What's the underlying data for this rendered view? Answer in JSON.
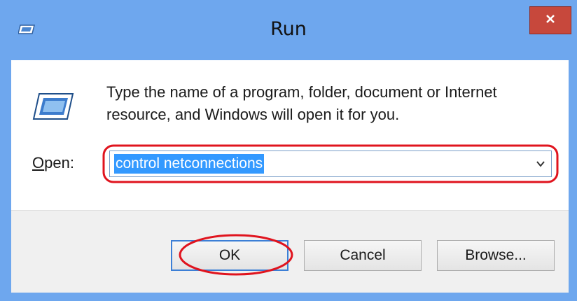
{
  "window": {
    "title": "Run",
    "title_color": "#6ea7ee",
    "close_icon": "close-icon"
  },
  "content": {
    "description": "Type the name of a program, folder, document or Internet resource, and Windows will open it for you.",
    "open_label": "Open:",
    "input_value": "control netconnections",
    "selection_color": "#3399ff"
  },
  "buttons": {
    "ok_label": "OK",
    "cancel_label": "Cancel",
    "browse_label": "Browse..."
  },
  "annotations": {
    "highlight_color": "#e0141e"
  }
}
